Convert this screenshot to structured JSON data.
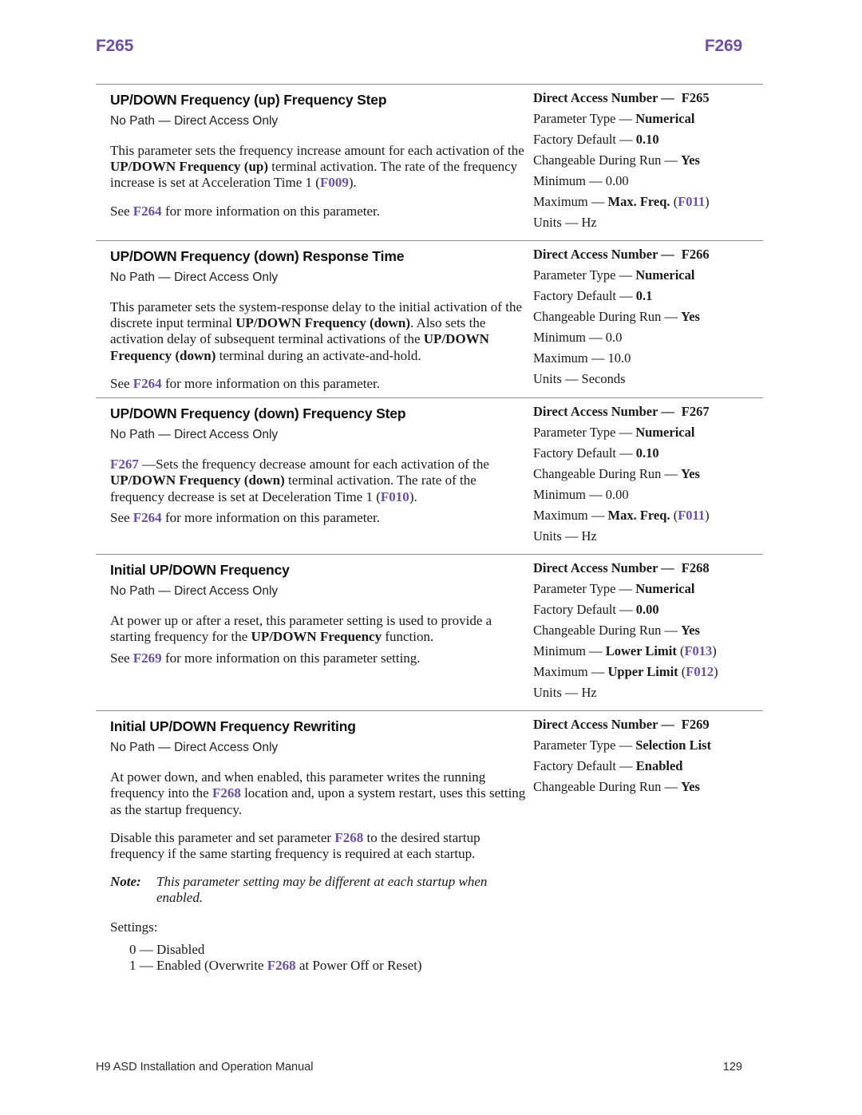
{
  "running_head": {
    "left": "F265",
    "right": "F269",
    "color": "#6f4fa6"
  },
  "sections": [
    {
      "title": "UP/DOWN Frequency (up) Frequency Step",
      "path": "No Path — Direct Access Only",
      "paragraphs": {
        "p1_a": "This parameter sets the frequency increase amount for each activation of the ",
        "p1_bold": "UP/DOWN Frequency (up)",
        "p1_b": " terminal activation. The rate of the frequency increase is set at Acceleration Time 1 (",
        "p1_ref": "F009",
        "p1_c": ").",
        "p2_a": "See ",
        "p2_ref": "F264",
        "p2_b": " for more information on this parameter."
      },
      "spec": {
        "dan_label": "Direct Access Number —",
        "dan_value": "F265",
        "type_label": "Parameter Type — ",
        "type_value": "Numerical",
        "default_label": "Factory Default — ",
        "default_value": "0.10",
        "run_label": "Changeable During Run — ",
        "run_value": "Yes",
        "min_label": "Minimum — ",
        "min_value": "0.00",
        "max_label": "Maximum — ",
        "max_value": "Max. Freq.",
        "max_ref_open": " (",
        "max_ref": "F011",
        "max_ref_close": ")",
        "units_label": "Units — ",
        "units_value": "Hz"
      }
    },
    {
      "title": "UP/DOWN Frequency (down) Response Time",
      "path": "No Path — Direct Access Only",
      "paragraphs": {
        "p1_a": "This parameter sets the system-response delay to the initial activation of the discrete input terminal ",
        "p1_bold": "UP/DOWN Frequency (down)",
        "p1_b": ". Also sets the activation delay of subsequent terminal activations of the ",
        "p1_bold2": "UP/DOWN Frequency (down)",
        "p1_c": " terminal during an activate-and-hold.",
        "p2_a": "See ",
        "p2_ref": "F264",
        "p2_b": " for more information on this parameter."
      },
      "spec": {
        "dan_label": "Direct Access Number —",
        "dan_value": "F266",
        "type_label": "Parameter Type — ",
        "type_value": "Numerical",
        "default_label": "Factory Default — ",
        "default_value": "0.1",
        "run_label": "Changeable During Run — ",
        "run_value": "Yes",
        "min_label": "Minimum — ",
        "min_value": "0.0",
        "max_label": "Maximum — ",
        "max_value": "10.0",
        "units_label": "Units — ",
        "units_value": "Seconds"
      }
    },
    {
      "title": "UP/DOWN Frequency (down) Frequency Step",
      "path": "No Path — Direct Access Only",
      "paragraphs": {
        "p1_ref": "F267",
        "p1_a": " —Sets the frequency decrease amount for each activation of the ",
        "p1_bold": "UP/DOWN Frequency (down)",
        "p1_b": " terminal activation. The rate of the frequency decrease is set at Deceleration Time 1 (",
        "p1_ref2": "F010",
        "p1_c": ").",
        "p2_a": "See ",
        "p2_ref": "F264",
        "p2_b": " for more information on this parameter."
      },
      "spec": {
        "dan_label": "Direct Access Number —",
        "dan_value": "F267",
        "type_label": "Parameter Type — ",
        "type_value": "Numerical",
        "default_label": "Factory Default — ",
        "default_value": "0.10",
        "run_label": "Changeable During Run — ",
        "run_value": "Yes",
        "min_label": "Minimum — ",
        "min_value": "0.00",
        "max_label": "Maximum — ",
        "max_value": "Max. Freq.",
        "max_ref_open": " (",
        "max_ref": "F011",
        "max_ref_close": ")",
        "units_label": "Units — ",
        "units_value": "Hz"
      }
    },
    {
      "title": "Initial UP/DOWN Frequency",
      "path": "No Path — Direct Access Only",
      "paragraphs": {
        "p1_a": "At power up or after a reset, this parameter setting is used to provide a starting frequency for the ",
        "p1_bold": "UP/DOWN Frequency",
        "p1_b": " function.",
        "p2_a": "See ",
        "p2_ref": "F269",
        "p2_b": " for more information on this parameter setting."
      },
      "spec": {
        "dan_label": "Direct Access Number —",
        "dan_value": "F268",
        "type_label": "Parameter Type — ",
        "type_value": "Numerical",
        "default_label": "Factory Default — ",
        "default_value": "0.00",
        "run_label": "Changeable During Run — ",
        "run_value": "Yes",
        "min_label": "Minimum — ",
        "min_value": "Lower Limit",
        "min_ref_open": " (",
        "min_ref": "F013",
        "min_ref_close": ")",
        "max_label": "Maximum — ",
        "max_value": "Upper Limit",
        "max_ref_open": " (",
        "max_ref": "F012",
        "max_ref_close": ")",
        "units_label": "Units — ",
        "units_value": "Hz"
      }
    },
    {
      "title": "Initial UP/DOWN Frequency Rewriting",
      "path": "No Path — Direct Access Only",
      "paragraphs": {
        "p1_a": "At power down, and when enabled, this parameter writes the running frequency into the ",
        "p1_ref": "F268",
        "p1_b": " location and, upon a system restart, uses this setting as the startup frequency.",
        "p2_a": "Disable this parameter and set parameter ",
        "p2_ref": "F268",
        "p2_b": " to the desired startup frequency if the same starting frequency is required at each startup."
      },
      "note": {
        "label": "Note:",
        "text": "This parameter setting may be different at each startup when enabled."
      },
      "settings": {
        "heading": "Settings:",
        "options": [
          {
            "index": "0 — ",
            "a": "Disabled"
          },
          {
            "index": "1 — ",
            "a": "Enabled (Overwrite ",
            "ref": "F268",
            "b": " at Power Off or Reset)"
          }
        ]
      },
      "spec": {
        "dan_label": "Direct Access Number —",
        "dan_value": "F269",
        "type_label": "Parameter Type — ",
        "type_value": "Selection List",
        "default_label": "Factory Default — ",
        "default_value": "Enabled",
        "run_label": "Changeable During Run — ",
        "run_value": "Yes"
      }
    }
  ],
  "footer": {
    "manual": "H9 ASD Installation and Operation Manual",
    "page": "129"
  }
}
